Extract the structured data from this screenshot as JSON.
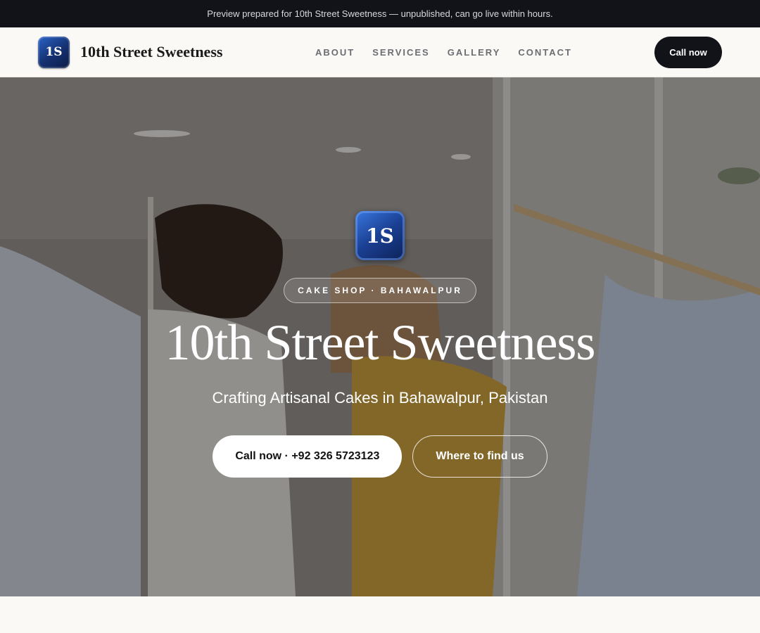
{
  "banner": {
    "text": "Preview prepared for 10th Street Sweetness — unpublished, can go live within hours."
  },
  "nav": {
    "logo_text": "1S",
    "brand_name": "10th Street Sweetness",
    "links": [
      "ABOUT",
      "SERVICES",
      "GALLERY",
      "CONTACT"
    ],
    "cta_label": "Call now"
  },
  "hero": {
    "logo_text": "1S",
    "eyebrow": "CAKE SHOP · BAHAWALPUR",
    "title": "10th Street Sweetness",
    "subtitle": "Crafting Artisanal Cakes in Bahawalpur, Pakistan",
    "primary_cta": "Call now · +92 326 5723123",
    "secondary_cta": "Where to find us"
  },
  "colors": {
    "dark": "#111318",
    "logo_blue": "#1a3f92",
    "background": "#faf9f6"
  },
  "icons": {
    "logo": "1s-monogram-icon"
  }
}
